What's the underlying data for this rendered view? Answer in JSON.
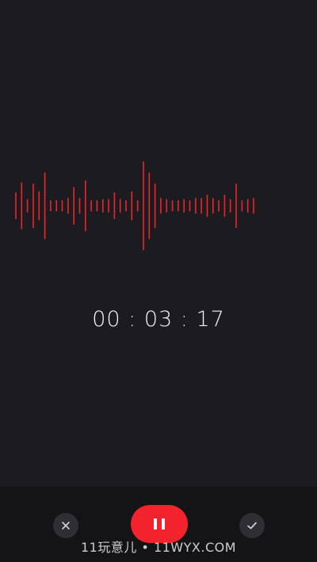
{
  "recorder": {
    "elapsed_time": "00 : 03 : 17",
    "waveform_amplitudes": [
      0.24,
      0.42,
      0.12,
      0.4,
      0.26,
      0.6,
      0.1,
      0.1,
      0.1,
      0.14,
      0.34,
      0.14,
      0.46,
      0.1,
      0.1,
      0.12,
      0.12,
      0.24,
      0.12,
      0.1,
      0.26,
      0.1,
      0.8,
      0.6,
      0.4,
      0.14,
      0.12,
      0.1,
      0.1,
      0.12,
      0.1,
      0.14,
      0.14,
      0.2,
      0.14,
      0.1,
      0.2,
      0.12,
      0.4,
      0.1,
      0.12,
      0.14
    ]
  },
  "controls": {
    "cancel_icon": "close-icon",
    "pause_icon": "pause-icon",
    "confirm_icon": "check-icon"
  },
  "watermark": {
    "text": "11玩意儿 • 11WYX.COM"
  },
  "colors": {
    "background": "#1c1c20",
    "bottom_bar": "#141416",
    "accent_red": "#f2232d",
    "waveform": "#e8262d"
  }
}
